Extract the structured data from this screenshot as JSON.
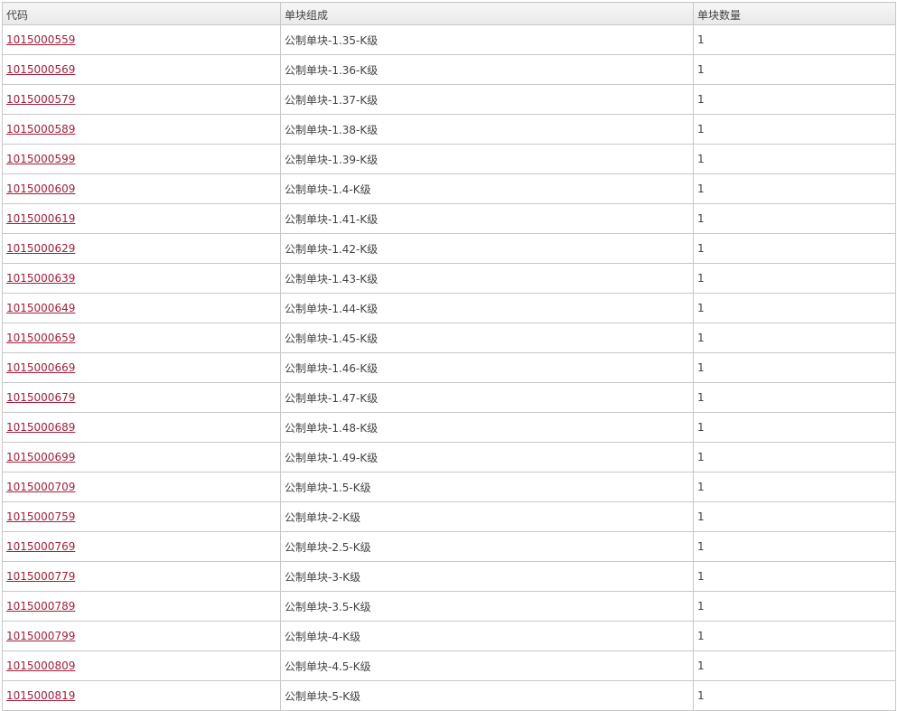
{
  "table": {
    "headers": [
      "代码",
      "单块组成",
      "单块数量"
    ],
    "rows": [
      {
        "code": "1015000559",
        "composition": "公制单块-1.35-K级",
        "quantity": "1"
      },
      {
        "code": "1015000569",
        "composition": "公制单块-1.36-K级",
        "quantity": "1"
      },
      {
        "code": "1015000579",
        "composition": "公制单块-1.37-K级",
        "quantity": "1"
      },
      {
        "code": "1015000589",
        "composition": "公制单块-1.38-K级",
        "quantity": "1"
      },
      {
        "code": "1015000599",
        "composition": "公制单块-1.39-K级",
        "quantity": "1"
      },
      {
        "code": "1015000609",
        "composition": "公制单块-1.4-K级",
        "quantity": "1"
      },
      {
        "code": "1015000619",
        "composition": "公制单块-1.41-K级",
        "quantity": "1"
      },
      {
        "code": "1015000629",
        "composition": "公制单块-1.42-K级",
        "quantity": "1"
      },
      {
        "code": "1015000639",
        "composition": "公制单块-1.43-K级",
        "quantity": "1"
      },
      {
        "code": "1015000649",
        "composition": "公制单块-1.44-K级",
        "quantity": "1"
      },
      {
        "code": "1015000659",
        "composition": "公制单块-1.45-K级",
        "quantity": "1"
      },
      {
        "code": "1015000669",
        "composition": "公制单块-1.46-K级",
        "quantity": "1"
      },
      {
        "code": "1015000679",
        "composition": "公制单块-1.47-K级",
        "quantity": "1"
      },
      {
        "code": "1015000689",
        "composition": "公制单块-1.48-K级",
        "quantity": "1"
      },
      {
        "code": "1015000699",
        "composition": "公制单块-1.49-K级",
        "quantity": "1"
      },
      {
        "code": "1015000709",
        "composition": "公制单块-1.5-K级",
        "quantity": "1"
      },
      {
        "code": "1015000759",
        "composition": "公制单块-2-K级",
        "quantity": "1"
      },
      {
        "code": "1015000769",
        "composition": "公制单块-2.5-K级",
        "quantity": "1"
      },
      {
        "code": "1015000779",
        "composition": "公制单块-3-K级",
        "quantity": "1"
      },
      {
        "code": "1015000789",
        "composition": "公制单块-3.5-K级",
        "quantity": "1"
      },
      {
        "code": "1015000799",
        "composition": "公制单块-4-K级",
        "quantity": "1"
      },
      {
        "code": "1015000809",
        "composition": "公制单块-4.5-K级",
        "quantity": "1"
      },
      {
        "code": "1015000819",
        "composition": "公制单块-5-K级",
        "quantity": "1"
      }
    ]
  },
  "colors": {
    "link": "#a0203c",
    "border": "#c8c8c8",
    "header_bg": "#eeeeee",
    "text": "#444444"
  }
}
